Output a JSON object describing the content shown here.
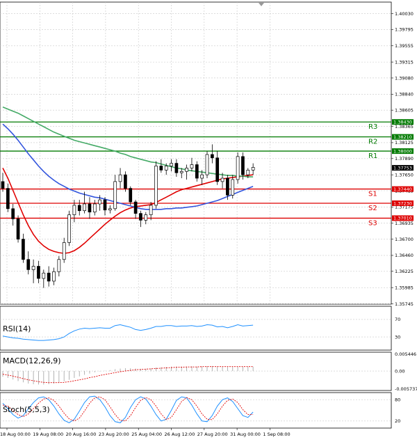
{
  "chart_data": {
    "type": "candlestick",
    "main": {
      "price_axis_ticks": [
        "1.40030",
        "1.39795",
        "1.39555",
        "1.39315",
        "1.39080",
        "1.38840",
        "1.38605",
        "1.38365",
        "1.38125",
        "1.37890",
        "1.37650",
        "1.37415",
        "1.37175",
        "1.36935",
        "1.36700",
        "1.36460",
        "1.36225",
        "1.35985",
        "1.35745"
      ],
      "price_axis_values": [
        1.4003,
        1.39795,
        1.39555,
        1.39315,
        1.3908,
        1.3884,
        1.38605,
        1.38365,
        1.38125,
        1.3789,
        1.3765,
        1.37415,
        1.37175,
        1.36935,
        1.367,
        1.3646,
        1.36225,
        1.35985,
        1.35745
      ],
      "ylim": [
        1.3574,
        1.402
      ],
      "current_price": 1.37753,
      "current_price_label": "1.37753",
      "levels": [
        {
          "name": "R3",
          "value": 1.3843,
          "label": "1.38430",
          "color": "#007a00"
        },
        {
          "name": "R2",
          "value": 1.3821,
          "label": "1.38210",
          "color": "#007a00"
        },
        {
          "name": "R1",
          "value": 1.38,
          "label": "1.38000",
          "color": "#007a00"
        },
        {
          "name": "S1",
          "value": 1.3744,
          "label": "1.37440",
          "color": "#dd0000"
        },
        {
          "name": "S2",
          "value": 1.3723,
          "label": "1.37230",
          "color": "#dd0000"
        },
        {
          "name": "S3",
          "value": 1.3701,
          "label": "1.37010",
          "color": "#dd0000"
        }
      ],
      "candles": [
        [
          1.3755,
          1.3768,
          1.374,
          1.3745
        ],
        [
          1.3745,
          1.3752,
          1.371,
          1.3715
        ],
        [
          1.3715,
          1.3722,
          1.369,
          1.37
        ],
        [
          1.37,
          1.3705,
          1.3665,
          1.367
        ],
        [
          1.367,
          1.3678,
          1.3635,
          1.364
        ],
        [
          1.364,
          1.3652,
          1.3618,
          1.3625
        ],
        [
          1.3625,
          1.364,
          1.3605,
          1.363
        ],
        [
          1.363,
          1.3638,
          1.3605,
          1.3612
        ],
        [
          1.3612,
          1.3625,
          1.3598,
          1.362
        ],
        [
          1.362,
          1.363,
          1.36,
          1.3608
        ],
        [
          1.3608,
          1.3628,
          1.3602,
          1.3622
        ],
        [
          1.3622,
          1.3645,
          1.3615,
          1.364
        ],
        [
          1.364,
          1.3672,
          1.3635,
          1.3665
        ],
        [
          1.3665,
          1.3712,
          1.366,
          1.3706
        ],
        [
          1.3706,
          1.3728,
          1.3695,
          1.372
        ],
        [
          1.372,
          1.3728,
          1.3705,
          1.3712
        ],
        [
          1.3712,
          1.374,
          1.3708,
          1.3722
        ],
        [
          1.3722,
          1.3732,
          1.37,
          1.371
        ],
        [
          1.371,
          1.3728,
          1.3705,
          1.3722
        ],
        [
          1.3722,
          1.3735,
          1.3712,
          1.3728
        ],
        [
          1.3728,
          1.3732,
          1.3705,
          1.3713
        ],
        [
          1.3713,
          1.372,
          1.3708,
          1.3715
        ],
        [
          1.3715,
          1.3765,
          1.3712,
          1.3755
        ],
        [
          1.3755,
          1.3775,
          1.3745,
          1.3765
        ],
        [
          1.3765,
          1.377,
          1.374,
          1.3745
        ],
        [
          1.3745,
          1.3748,
          1.372,
          1.3725
        ],
        [
          1.3725,
          1.3728,
          1.37,
          1.3708
        ],
        [
          1.3708,
          1.3712,
          1.3688,
          1.3698
        ],
        [
          1.3698,
          1.371,
          1.3692,
          1.3706
        ],
        [
          1.3706,
          1.3725,
          1.3698,
          1.372
        ],
        [
          1.372,
          1.3785,
          1.3715,
          1.3778
        ],
        [
          1.3778,
          1.3788,
          1.3768,
          1.3772
        ],
        [
          1.3772,
          1.3782,
          1.3765,
          1.3778
        ],
        [
          1.3778,
          1.3788,
          1.377,
          1.3782
        ],
        [
          1.3782,
          1.3788,
          1.3762,
          1.3768
        ],
        [
          1.3768,
          1.3775,
          1.376,
          1.377
        ],
        [
          1.377,
          1.378,
          1.3758,
          1.3775
        ],
        [
          1.3775,
          1.379,
          1.377,
          1.378
        ],
        [
          1.378,
          1.3785,
          1.3755,
          1.376
        ],
        [
          1.376,
          1.3772,
          1.375,
          1.3765
        ],
        [
          1.3765,
          1.38,
          1.376,
          1.3795
        ],
        [
          1.3795,
          1.381,
          1.3782,
          1.379
        ],
        [
          1.379,
          1.38,
          1.375,
          1.3755
        ],
        [
          1.3755,
          1.3768,
          1.3745,
          1.376
        ],
        [
          1.376,
          1.3765,
          1.3728,
          1.3735
        ],
        [
          1.3735,
          1.3765,
          1.373,
          1.3758
        ],
        [
          1.3758,
          1.3798,
          1.3752,
          1.3792
        ],
        [
          1.3792,
          1.3798,
          1.3758,
          1.3765
        ],
        [
          1.3765,
          1.3775,
          1.376,
          1.3772
        ],
        [
          1.3772,
          1.3782,
          1.3765,
          1.3776
        ]
      ],
      "ma_series": [
        {
          "name": "red",
          "color": "#e00000",
          "values": [
            1.3775,
            1.376,
            1.3742,
            1.3724,
            1.3706,
            1.369,
            1.3677,
            1.3667,
            1.366,
            1.3655,
            1.3652,
            1.365,
            1.3649,
            1.365,
            1.3653,
            1.3658,
            1.3664,
            1.3671,
            1.3678,
            1.3685,
            1.3692,
            1.3698,
            1.3704,
            1.3709,
            1.3713,
            1.3716,
            1.3718,
            1.3719,
            1.372,
            1.3721,
            1.3724,
            1.3728,
            1.3732,
            1.3736,
            1.374,
            1.3743,
            1.3745,
            1.3747,
            1.3749,
            1.3751,
            1.3753,
            1.3755,
            1.3757,
            1.3759,
            1.376,
            1.3761,
            1.3762,
            1.3763,
            1.3764,
            1.3765
          ]
        },
        {
          "name": "blue",
          "color": "#3355dd",
          "values": [
            1.384,
            1.3833,
            1.3825,
            1.3816,
            1.3806,
            1.3796,
            1.3787,
            1.3778,
            1.377,
            1.3763,
            1.3757,
            1.3752,
            1.3748,
            1.3744,
            1.3741,
            1.3738,
            1.3736,
            1.3734,
            1.3732,
            1.3731,
            1.3729,
            1.3727,
            1.3725,
            1.3723,
            1.3721,
            1.3719,
            1.3717,
            1.3715,
            1.3714,
            1.3714,
            1.3714,
            1.3714,
            1.3715,
            1.3715,
            1.3716,
            1.3716,
            1.3717,
            1.3718,
            1.3719,
            1.3721,
            1.3723,
            1.3725,
            1.3727,
            1.373,
            1.3733,
            1.3736,
            1.3739,
            1.3742,
            1.3745,
            1.3748
          ]
        },
        {
          "name": "green",
          "color": "#44aa66",
          "values": [
            1.3865,
            1.3862,
            1.3859,
            1.3856,
            1.3852,
            1.3848,
            1.3844,
            1.384,
            1.3836,
            1.3832,
            1.3828,
            1.3825,
            1.3822,
            1.3819,
            1.3816,
            1.3814,
            1.3812,
            1.381,
            1.3808,
            1.3806,
            1.3804,
            1.3802,
            1.38,
            1.3797,
            1.3795,
            1.3792,
            1.379,
            1.3788,
            1.3786,
            1.3784,
            1.3783,
            1.3781,
            1.3779,
            1.3777,
            1.3775,
            1.3774,
            1.3772,
            1.3771,
            1.377,
            1.3769,
            1.3768,
            1.3767,
            1.3766,
            1.3765,
            1.3764,
            1.3764,
            1.3763,
            1.3763,
            1.3762,
            1.3762
          ]
        }
      ]
    },
    "date_labels": [
      "18 Aug 00:00",
      "19 Aug 08:00",
      "20 Aug 16:00",
      "23 Aug 20:00",
      "25 Aug 04:00",
      "26 Aug 12:00",
      "27 Aug 20:00",
      "31 Aug 00:00",
      "1 Sep 08:00"
    ],
    "rsi": {
      "label": "RSI(14)",
      "ticks": [
        "70",
        "30"
      ],
      "tick_values": [
        70,
        30
      ],
      "ylim": [
        0,
        100
      ],
      "values": [
        32,
        30,
        28,
        27,
        25,
        24,
        23,
        22,
        22,
        23,
        24,
        26,
        30,
        38,
        44,
        48,
        50,
        49,
        50,
        51,
        50,
        50,
        56,
        58,
        55,
        52,
        47,
        45,
        47,
        50,
        54,
        54,
        56,
        56,
        54,
        55,
        55,
        56,
        54,
        55,
        58,
        57,
        53,
        54,
        51,
        54,
        58,
        55,
        56,
        57
      ]
    },
    "macd": {
      "label": "MACD(12,26,9)",
      "ticks": [
        "0.005446",
        "0.00",
        "-0.005737"
      ],
      "tick_values": [
        0.005446,
        0.0,
        -0.005737
      ],
      "ylim": [
        -0.0062,
        0.006
      ],
      "histogram": [
        -0.0018,
        -0.0022,
        -0.0027,
        -0.0032,
        -0.0036,
        -0.004,
        -0.0042,
        -0.0043,
        -0.0043,
        -0.0042,
        -0.004,
        -0.0037,
        -0.0033,
        -0.0028,
        -0.0022,
        -0.0017,
        -0.0012,
        -0.0008,
        -0.0004,
        -0.0001,
        0.0001,
        0.0003,
        0.0006,
        0.0008,
        0.0009,
        0.0009,
        0.0008,
        0.0007,
        0.0007,
        0.0008,
        0.0011,
        0.0012,
        0.0013,
        0.0014,
        0.0014,
        0.0014,
        0.0014,
        0.0015,
        0.0014,
        0.0014,
        0.0015,
        0.0016,
        0.0015,
        0.0014,
        0.0013,
        0.0013,
        0.0014,
        0.0014,
        0.0014,
        0.0014
      ],
      "signal": [
        -0.001,
        -0.0013,
        -0.0016,
        -0.002,
        -0.0024,
        -0.0028,
        -0.0031,
        -0.0034,
        -0.0036,
        -0.0037,
        -0.0037,
        -0.0037,
        -0.0036,
        -0.0034,
        -0.0031,
        -0.0028,
        -0.0025,
        -0.0021,
        -0.0018,
        -0.0014,
        -0.0011,
        -0.0008,
        -0.0005,
        -0.0002,
        0.0,
        0.0002,
        0.0004,
        0.0005,
        0.0006,
        0.0007,
        0.0008,
        0.0009,
        0.001,
        0.0011,
        0.0012,
        0.0012,
        0.0013,
        0.0013,
        0.0013,
        0.0014,
        0.0014,
        0.0014,
        0.0014,
        0.0014,
        0.0014,
        0.0014,
        0.0014,
        0.0014,
        0.0014,
        0.0014
      ]
    },
    "stoch": {
      "label": "Stoch(5,5,3)",
      "ticks": [
        "80",
        "20"
      ],
      "tick_values": [
        80,
        20
      ],
      "ylim": [
        0,
        100
      ],
      "k": [
        70,
        55,
        38,
        28,
        35,
        55,
        72,
        85,
        88,
        80,
        62,
        40,
        22,
        15,
        25,
        48,
        72,
        88,
        90,
        80,
        60,
        35,
        18,
        15,
        30,
        58,
        80,
        88,
        82,
        62,
        38,
        20,
        25,
        50,
        78,
        88,
        85,
        65,
        40,
        20,
        18,
        35,
        62,
        80,
        85,
        75,
        55,
        35,
        30,
        45
      ],
      "d": [
        65,
        62,
        50,
        38,
        32,
        40,
        55,
        70,
        82,
        85,
        78,
        62,
        42,
        26,
        20,
        28,
        48,
        70,
        85,
        88,
        80,
        60,
        38,
        22,
        20,
        35,
        58,
        78,
        86,
        80,
        62,
        40,
        24,
        30,
        52,
        75,
        86,
        80,
        62,
        40,
        25,
        24,
        40,
        62,
        78,
        82,
        72,
        52,
        38,
        38
      ]
    }
  }
}
